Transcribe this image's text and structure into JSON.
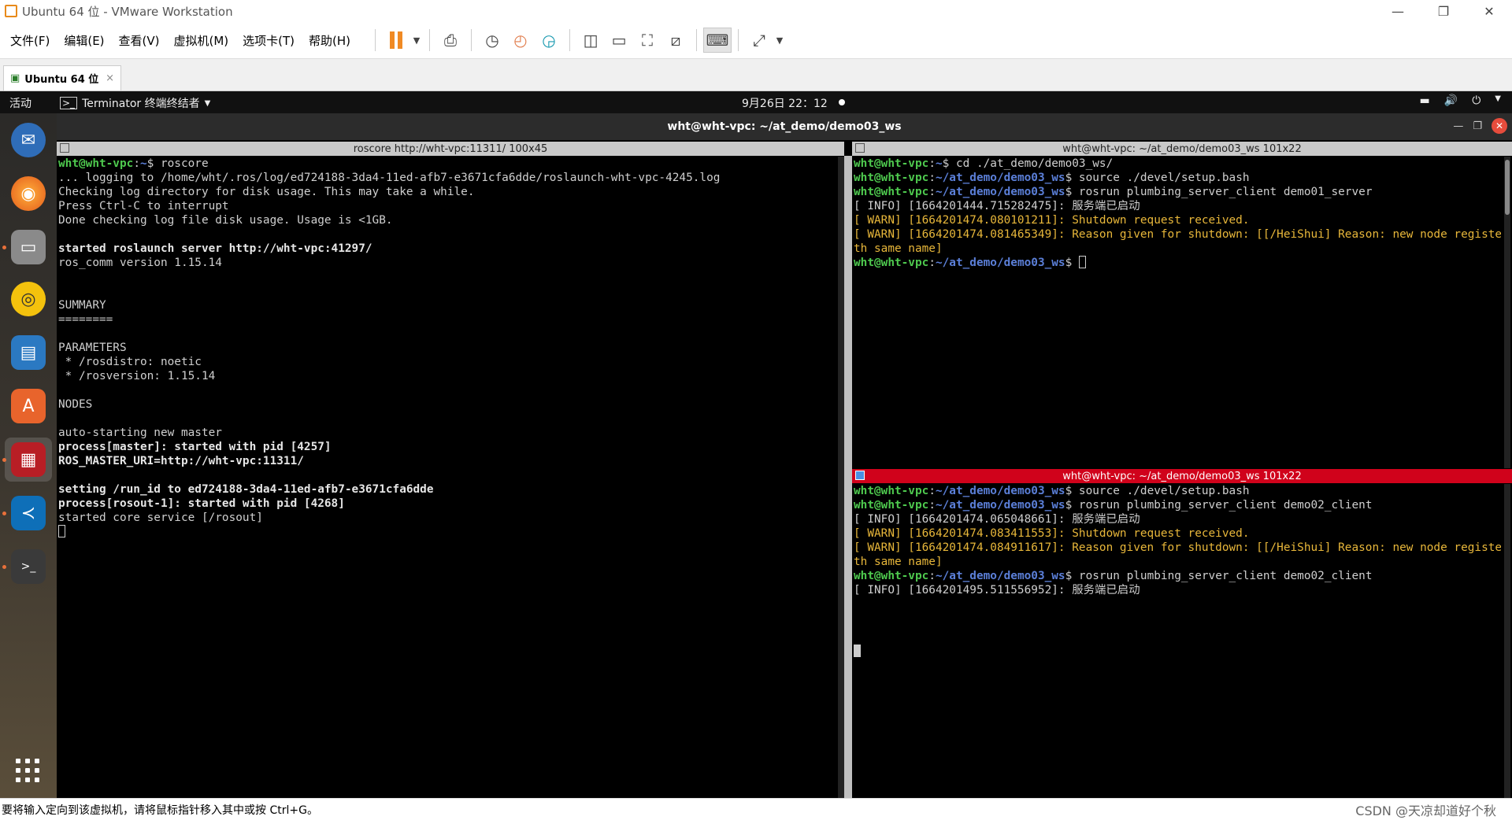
{
  "window": {
    "title": "Ubuntu 64 位 - VMware Workstation",
    "min": "—",
    "restore": "❐",
    "close": "✕"
  },
  "menu": [
    "文件(F)",
    "编辑(E)",
    "查看(V)",
    "虚拟机(M)",
    "选项卡(T)",
    "帮助(H)"
  ],
  "tab": {
    "label": "Ubuntu 64 位",
    "close": "×"
  },
  "topbar": {
    "activities": "活动",
    "app": "Terminator 终端终结者",
    "clock": "9月26日 22：12"
  },
  "terminator": {
    "title": "wht@wht-vpc: ~/at_demo/demo03_ws"
  },
  "panes": {
    "left": {
      "header": "roscore http://wht-vpc:11311/ 100x45",
      "lines": [
        {
          "p": "wht@wht-vpc",
          "d": "~",
          "c": "$ roscore"
        },
        {
          "t": "... logging to /home/wht/.ros/log/ed724188-3da4-11ed-afb7-e3671cfa6dde/roslaunch-wht-vpc-4245.log"
        },
        {
          "t": "Checking log directory for disk usage. This may take a while."
        },
        {
          "t": "Press Ctrl-C to interrupt"
        },
        {
          "t": "Done checking log file disk usage. Usage is <1GB."
        },
        {
          "t": ""
        },
        {
          "b": "started roslaunch server http://wht-vpc:41297/"
        },
        {
          "t": "ros_comm version 1.15.14"
        },
        {
          "t": ""
        },
        {
          "t": ""
        },
        {
          "t": "SUMMARY"
        },
        {
          "t": "========"
        },
        {
          "t": ""
        },
        {
          "t": "PARAMETERS"
        },
        {
          "t": " * /rosdistro: noetic"
        },
        {
          "t": " * /rosversion: 1.15.14"
        },
        {
          "t": ""
        },
        {
          "t": "NODES"
        },
        {
          "t": ""
        },
        {
          "t": "auto-starting new master"
        },
        {
          "b": "process[master]: started with pid [4257]"
        },
        {
          "b": "ROS_MASTER_URI=http://wht-vpc:11311/"
        },
        {
          "t": ""
        },
        {
          "b": "setting /run_id to ed724188-3da4-11ed-afb7-e3671cfa6dde"
        },
        {
          "b": "process[rosout-1]: started with pid [4268]"
        },
        {
          "t": "started core service [/rosout]"
        }
      ]
    },
    "top_right": {
      "header": "wht@wht-vpc: ~/at_demo/demo03_ws 101x22",
      "lines": [
        {
          "p": "wht@wht-vpc",
          "d": "~",
          "c": "$ cd ./at_demo/demo03_ws/"
        },
        {
          "p": "wht@wht-vpc",
          "d": "~/at_demo/demo03_ws",
          "c": "$ source ./devel/setup.bash"
        },
        {
          "p": "wht@wht-vpc",
          "d": "~/at_demo/demo03_ws",
          "c": "$ rosrun plumbing_server_client demo01_server"
        },
        {
          "t": "[ INFO] [1664201444.715282475]: 服务端已启动"
        },
        {
          "w": "[ WARN] [1664201474.080101211]: Shutdown request received."
        },
        {
          "w": "[ WARN] [1664201474.081465349]: Reason given for shutdown: [[/HeiShui] Reason: new node registered wi"
        },
        {
          "w": "th same name]"
        },
        {
          "p": "wht@wht-vpc",
          "d": "~/at_demo/demo03_ws",
          "c": "$ "
        }
      ]
    },
    "bottom_right": {
      "header": "wht@wht-vpc: ~/at_demo/demo03_ws 101x22",
      "lines": [
        {
          "p": "wht@wht-vpc",
          "d": "~/at_demo/demo03_ws",
          "c": "$ source ./devel/setup.bash"
        },
        {
          "p": "wht@wht-vpc",
          "d": "~/at_demo/demo03_ws",
          "c": "$ rosrun plumbing_server_client demo02_client"
        },
        {
          "t": "[ INFO] [1664201474.065048661]: 服务端已启动"
        },
        {
          "w": "[ WARN] [1664201474.083411553]: Shutdown request received."
        },
        {
          "w": "[ WARN] [1664201474.084911617]: Reason given for shutdown: [[/HeiShui] Reason: new node registered wi"
        },
        {
          "w": "th same name]"
        },
        {
          "p": "wht@wht-vpc",
          "d": "~/at_demo/demo03_ws",
          "c": "$ rosrun plumbing_server_client demo02_client"
        },
        {
          "t": "[ INFO] [1664201495.511556952]: 服务端已启动"
        }
      ]
    }
  },
  "statusbar": {
    "text": "要将输入定向到该虚拟机，请将鼠标指针移入其中或按 Ctrl+G。",
    "watermark": "CSDN @天凉却道好个秋"
  },
  "colors": {
    "prompt_user": "#4ec94e",
    "prompt_dir": "#5b7fd8",
    "warn": "#e8b73a",
    "active_header": "#d0021b"
  }
}
